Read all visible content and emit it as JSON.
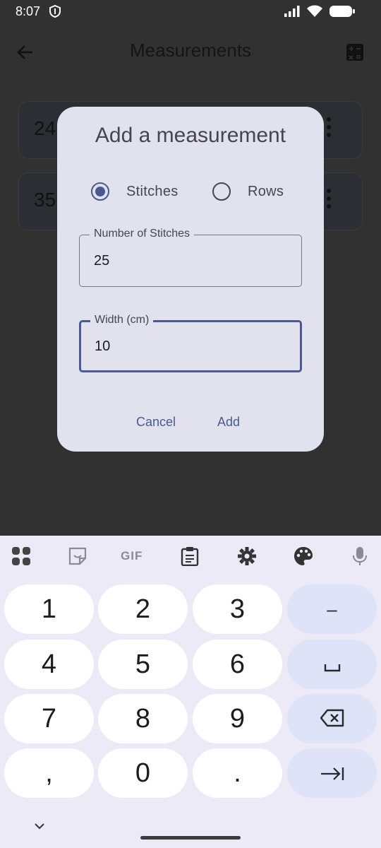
{
  "status_bar": {
    "time": "8:07"
  },
  "app_bar": {
    "title": "Measurements"
  },
  "background_list": [
    {
      "value": "24"
    },
    {
      "value": "35"
    }
  ],
  "dialog": {
    "title": "Add a measurement",
    "options": [
      {
        "label": "Stitches",
        "selected": true
      },
      {
        "label": "Rows",
        "selected": false
      }
    ],
    "fields": [
      {
        "label": "Number of Stitches",
        "value": "25",
        "focused": false
      },
      {
        "label": "Width (cm)",
        "value": "10",
        "focused": true
      }
    ],
    "cancel_label": "Cancel",
    "add_label": "Add"
  },
  "keyboard": {
    "toolbar": [
      "apps-grid-icon",
      "sticker-icon",
      "gif",
      "clipboard-icon",
      "settings-gear-icon",
      "palette-icon",
      "microphone-icon"
    ],
    "gif_label": "GIF",
    "keys": [
      [
        "1",
        "2",
        "3",
        "–"
      ],
      [
        "4",
        "5",
        "6",
        "␣"
      ],
      [
        "7",
        "8",
        "9",
        "⌫"
      ],
      [
        ",",
        "0",
        ".",
        "⇥"
      ]
    ]
  },
  "colors": {
    "accent": "#4a5a91",
    "dialog_bg": "#e2e2ee",
    "scrim": "#313131",
    "keyboard_bg": "#eceaf6",
    "function_key": "#dfe3f7"
  }
}
